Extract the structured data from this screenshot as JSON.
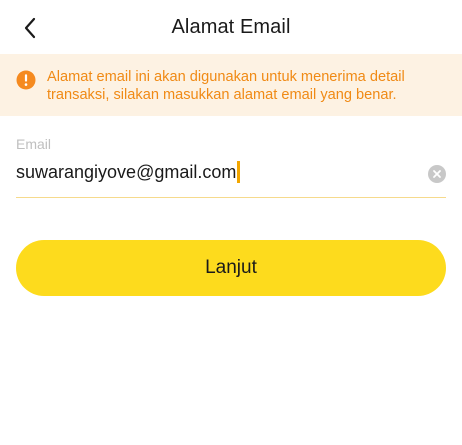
{
  "header": {
    "title": "Alamat Email",
    "back_icon": "chevron-left-icon"
  },
  "notice": {
    "icon": "warning-circle-icon",
    "text": "Alamat email ini akan digunakan untuk menerima detail transaksi, silakan masukkan alamat email yang benar.",
    "color": "#f08a15",
    "background": "#fdf2e3"
  },
  "email_field": {
    "label": "Email",
    "value": "suwarangiyove@gmail.com",
    "clear_icon": "clear-circle-icon"
  },
  "submit": {
    "label": "Lanjut",
    "color": "#fddb1d"
  }
}
